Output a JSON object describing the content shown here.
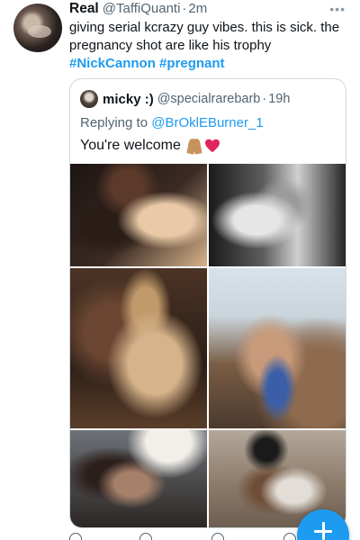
{
  "tweet": {
    "display_name": "Real",
    "handle": "@TaffiQuanti",
    "separator": "·",
    "time": "2m",
    "text_line1": "giving serial kcrazy guy vibes. this is sick. the",
    "text_line2": "pregnancy shot are like his trophy",
    "hashtags": [
      "#NickCannon",
      "#pregnant"
    ],
    "more_icon": "more-horizontal-icon"
  },
  "quoted_tweet": {
    "display_name": "micky :)",
    "handle": "@specialrarebarb",
    "separator": "·",
    "time": "19h",
    "replying_prefix": "Replying to",
    "replying_handle": "@BrOklEBurner_1",
    "text": "You're welcome",
    "emoji_icons": [
      "folded-hands-icon",
      "red-heart-icon"
    ],
    "photos": [
      "photo-1",
      "photo-2",
      "photo-3",
      "photo-4",
      "photo-5",
      "photo-6"
    ]
  },
  "compose_fab": {
    "icon": "plus-icon"
  },
  "action_bar": {
    "icons": [
      "reply-icon",
      "retweet-icon",
      "like-icon",
      "share-icon"
    ]
  },
  "colors": {
    "accent": "#1d9bf0",
    "text": "#0f1419",
    "secondary": "#536471",
    "border": "#cfd9de",
    "heart": "#e0245e"
  }
}
